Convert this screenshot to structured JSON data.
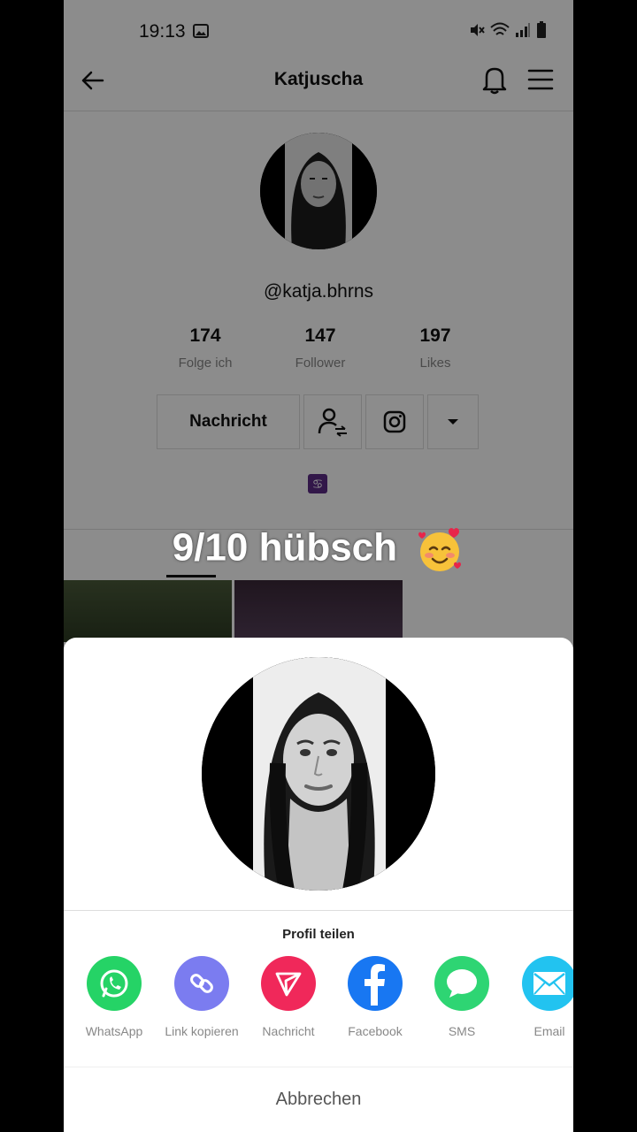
{
  "status_bar": {
    "time": "19:13"
  },
  "header": {
    "title": "Katjuscha"
  },
  "profile": {
    "username": "@katja.bhrns",
    "stats": [
      {
        "value": "174",
        "label": "Folge ich"
      },
      {
        "value": "147",
        "label": "Follower"
      },
      {
        "value": "197",
        "label": "Likes"
      }
    ],
    "message_button": "Nachricht",
    "zodiac_badge": "♋"
  },
  "overlay": {
    "caption": "9/10 hübsch"
  },
  "share_sheet": {
    "title": "Profil teilen",
    "targets": [
      {
        "label": "WhatsApp",
        "color": "#25d366",
        "icon": "whatsapp-icon"
      },
      {
        "label": "Link kopieren",
        "color": "#7b7cf0",
        "icon": "link-icon"
      },
      {
        "label": "Nachricht",
        "color": "#f0285a",
        "icon": "send-icon"
      },
      {
        "label": "Facebook",
        "color": "#1877f2",
        "icon": "facebook-icon"
      },
      {
        "label": "SMS",
        "color": "#2ed573",
        "icon": "sms-icon"
      },
      {
        "label": "Email",
        "color": "#22c3f0",
        "icon": "email-icon"
      }
    ],
    "cancel": "Abbrechen"
  }
}
